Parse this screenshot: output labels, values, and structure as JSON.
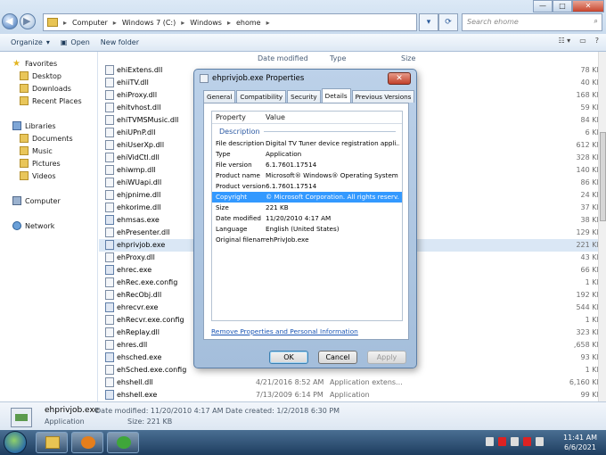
{
  "breadcrumb": [
    "Computer",
    "Windows 7 (C:)",
    "Windows",
    "ehome"
  ],
  "search_placeholder": "Search ehome",
  "toolbar": {
    "organize": "Organize",
    "open": "Open",
    "new_folder": "New folder"
  },
  "nav": {
    "favorites": "Favorites",
    "favorites_items": [
      "Desktop",
      "Downloads",
      "Recent Places"
    ],
    "libraries": "Libraries",
    "library_items": [
      "Documents",
      "Music",
      "Pictures",
      "Videos"
    ],
    "computer": "Computer",
    "network": "Network"
  },
  "columns": {
    "date": "Date modified",
    "type": "Type",
    "size": "Size"
  },
  "files": [
    {
      "name": "ehiExtens.dll",
      "date": "",
      "type": "",
      "size": "78 KB"
    },
    {
      "name": "ehiiTV.dll",
      "date": "",
      "type": "",
      "size": "40 KB"
    },
    {
      "name": "ehiProxy.dll",
      "date": "",
      "type": "",
      "size": "168 KB"
    },
    {
      "name": "ehitvhost.dll",
      "date": "",
      "type": "",
      "size": "59 KB"
    },
    {
      "name": "ehiTVMSMusic.dll",
      "date": "",
      "type": "",
      "size": "84 KB"
    },
    {
      "name": "ehiUPnP.dll",
      "date": "",
      "type": "",
      "size": "6 KB"
    },
    {
      "name": "ehiUserXp.dll",
      "date": "",
      "type": "",
      "size": "612 KB"
    },
    {
      "name": "ehiVidCtl.dll",
      "date": "",
      "type": "",
      "size": "328 KB"
    },
    {
      "name": "ehiwmp.dll",
      "date": "",
      "type": "",
      "size": "140 KB"
    },
    {
      "name": "ehiWUapi.dll",
      "date": "",
      "type": "",
      "size": "86 KB"
    },
    {
      "name": "ehjpnime.dll",
      "date": "",
      "type": "",
      "size": "24 KB"
    },
    {
      "name": "ehkorime.dll",
      "date": "",
      "type": "",
      "size": "37 KB"
    },
    {
      "name": "ehmsas.exe",
      "date": "",
      "type": "",
      "size": "38 KB"
    },
    {
      "name": "ehPresenter.dll",
      "date": "",
      "type": "",
      "size": "129 KB"
    },
    {
      "name": "ehprivjob.exe",
      "date": "",
      "type": "",
      "size": "221 KB"
    },
    {
      "name": "ehProxy.dll",
      "date": "",
      "type": "",
      "size": "43 KB"
    },
    {
      "name": "ehrec.exe",
      "date": "",
      "type": "",
      "size": "66 KB"
    },
    {
      "name": "ehRec.exe.config",
      "date": "",
      "type": "",
      "size": "1 KB"
    },
    {
      "name": "ehRecObj.dll",
      "date": "",
      "type": "",
      "size": "192 KB"
    },
    {
      "name": "ehrecvr.exe",
      "date": "",
      "type": "",
      "size": "544 KB"
    },
    {
      "name": "ehRecvr.exe.config",
      "date": "",
      "type": "",
      "size": "1 KB"
    },
    {
      "name": "ehReplay.dll",
      "date": "",
      "type": "",
      "size": "323 KB"
    },
    {
      "name": "ehres.dll",
      "date": "",
      "type": "",
      "size": ",658 KB"
    },
    {
      "name": "ehsched.exe",
      "date": "",
      "type": "",
      "size": "93 KB"
    },
    {
      "name": "ehSched.exe.config",
      "date": "",
      "type": "",
      "size": "1 KB"
    },
    {
      "name": "ehshell.dll",
      "date": "4/21/2016 8:52 AM",
      "type": "Application extens...",
      "size": "6,160 KB"
    },
    {
      "name": "ehshell.exe",
      "date": "7/13/2009 6:14 PM",
      "type": "Application",
      "size": "99 KB"
    }
  ],
  "status": {
    "name": "ehprivjob.exe",
    "kind": "Application",
    "modified": "Date modified: 11/20/2010 4:17 AM",
    "created": "Date created: 1/2/2018 6:30 PM",
    "size": "Size: 221 KB"
  },
  "dialog": {
    "title": "ehprivjob.exe Properties",
    "close": "✕",
    "tabs": [
      "General",
      "Compatibility",
      "Security",
      "Details",
      "Previous Versions"
    ],
    "col_property": "Property",
    "col_value": "Value",
    "group": "Description",
    "rows": [
      {
        "k": "File description",
        "v": "Digital TV Tuner device registration appli..."
      },
      {
        "k": "Type",
        "v": "Application"
      },
      {
        "k": "File version",
        "v": "6.1.7601.17514"
      },
      {
        "k": "Product name",
        "v": "Microsoft® Windows® Operating System"
      },
      {
        "k": "Product version",
        "v": "6.1.7601.17514"
      },
      {
        "k": "Copyright",
        "v": "© Microsoft Corporation. All rights reserv..."
      },
      {
        "k": "Size",
        "v": "221 KB"
      },
      {
        "k": "Date modified",
        "v": "11/20/2010 4:17 AM"
      },
      {
        "k": "Language",
        "v": "English (United States)"
      },
      {
        "k": "Original filename",
        "v": "ehPrivJob.exe"
      }
    ],
    "link": "Remove Properties and Personal Information",
    "ok": "OK",
    "cancel": "Cancel",
    "apply": "Apply"
  },
  "clock": {
    "time": "11:41 AM",
    "date": "6/6/2021"
  }
}
